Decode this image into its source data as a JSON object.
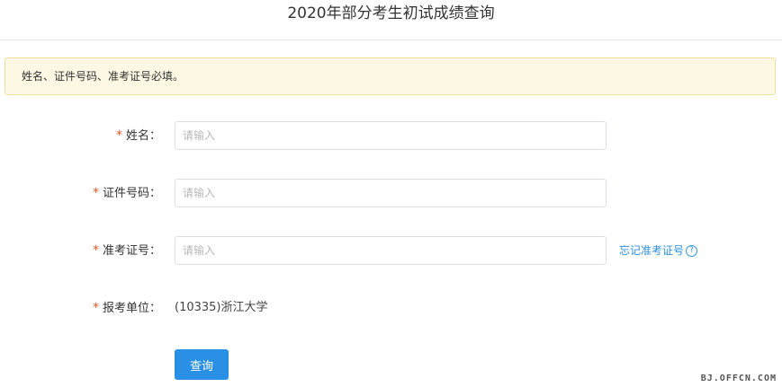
{
  "header": {
    "title": "2020年部分考生初试成绩查询"
  },
  "notice": {
    "text": "姓名、证件号码、准考证号必填。"
  },
  "form": {
    "required_mark": "*",
    "name": {
      "label": "姓名：",
      "placeholder": "请输入",
      "value": ""
    },
    "id_number": {
      "label": "证件号码：",
      "placeholder": "请输入",
      "value": ""
    },
    "exam_number": {
      "label": "准考证号：",
      "placeholder": "请输入",
      "value": "",
      "forgot_link": "忘记准考证号",
      "help_glyph": "?"
    },
    "unit": {
      "label": "报考单位：",
      "value": "(10335)浙江大学"
    },
    "submit_label": "查询"
  },
  "watermark": "BJ.OFFCN.COM",
  "colors": {
    "accent": "#2a90e6",
    "link": "#2f8fdb",
    "required": "#e4572e",
    "notice_bg": "#fcf8e3",
    "notice_border": "#f3df9c"
  }
}
